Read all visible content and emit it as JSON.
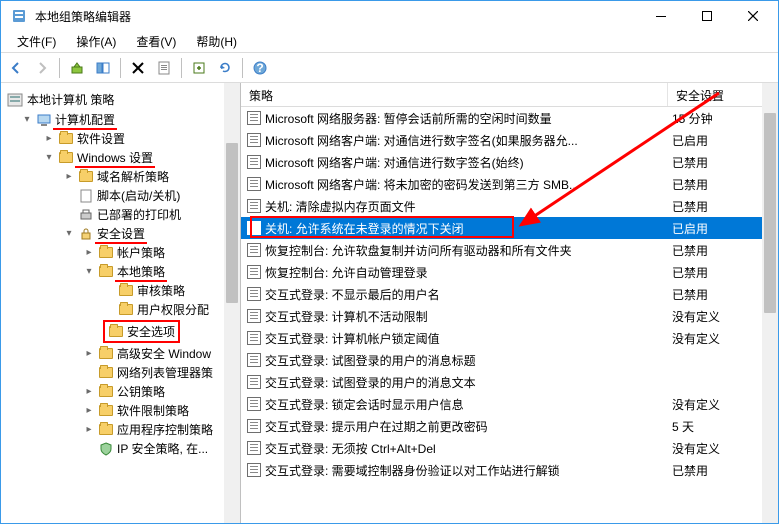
{
  "window": {
    "title": "本地组策略编辑器"
  },
  "menu": {
    "file": "文件(F)",
    "action": "操作(A)",
    "view": "查看(V)",
    "help": "帮助(H)"
  },
  "tree": {
    "root": "本地计算机 策略",
    "computer_config": "计算机配置",
    "software_settings": "软件设置",
    "windows_settings": "Windows 设置",
    "name_resolution": "域名解析策略",
    "scripts": "脚本(启动/关机)",
    "deployed_printers": "已部署的打印机",
    "security_settings": "安全设置",
    "account_policies": "帐户策略",
    "local_policies": "本地策略",
    "audit_policy": "审核策略",
    "user_rights": "用户权限分配",
    "security_options": "安全选项",
    "advanced_windows": "高级安全 Window",
    "network_list": "网络列表管理器策",
    "public_key": "公钥策略",
    "software_restriction": "软件限制策略",
    "app_control": "应用程序控制策略",
    "ip_security": "IP 安全策略, 在..."
  },
  "list": {
    "col_policy": "策略",
    "col_setting": "安全设置",
    "rows": [
      {
        "label": "Microsoft 网络服务器: 暂停会话前所需的空闲时间数量",
        "value": "15 分钟"
      },
      {
        "label": "Microsoft 网络客户端: 对通信进行数字签名(如果服务器允...",
        "value": "已启用"
      },
      {
        "label": "Microsoft 网络客户端: 对通信进行数字签名(始终)",
        "value": "已禁用"
      },
      {
        "label": "Microsoft 网络客户端: 将未加密的密码发送到第三方 SMB...",
        "value": "已禁用"
      },
      {
        "label": "关机: 清除虚拟内存页面文件",
        "value": "已禁用"
      },
      {
        "label": "关机: 允许系统在未登录的情况下关闭",
        "value": "已启用",
        "selected": true
      },
      {
        "label": "恢复控制台: 允许软盘复制并访问所有驱动器和所有文件夹",
        "value": "已禁用"
      },
      {
        "label": "恢复控制台: 允许自动管理登录",
        "value": "已禁用"
      },
      {
        "label": "交互式登录: 不显示最后的用户名",
        "value": "已禁用"
      },
      {
        "label": "交互式登录: 计算机不活动限制",
        "value": "没有定义"
      },
      {
        "label": "交互式登录: 计算机帐户锁定阈值",
        "value": "没有定义"
      },
      {
        "label": "交互式登录: 试图登录的用户的消息标题",
        "value": ""
      },
      {
        "label": "交互式登录: 试图登录的用户的消息文本",
        "value": ""
      },
      {
        "label": "交互式登录: 锁定会话时显示用户信息",
        "value": "没有定义"
      },
      {
        "label": "交互式登录: 提示用户在过期之前更改密码",
        "value": "5 天"
      },
      {
        "label": "交互式登录: 无须按 Ctrl+Alt+Del",
        "value": "没有定义"
      },
      {
        "label": "交互式登录: 需要域控制器身份验证以对工作站进行解锁",
        "value": "已禁用"
      }
    ]
  }
}
